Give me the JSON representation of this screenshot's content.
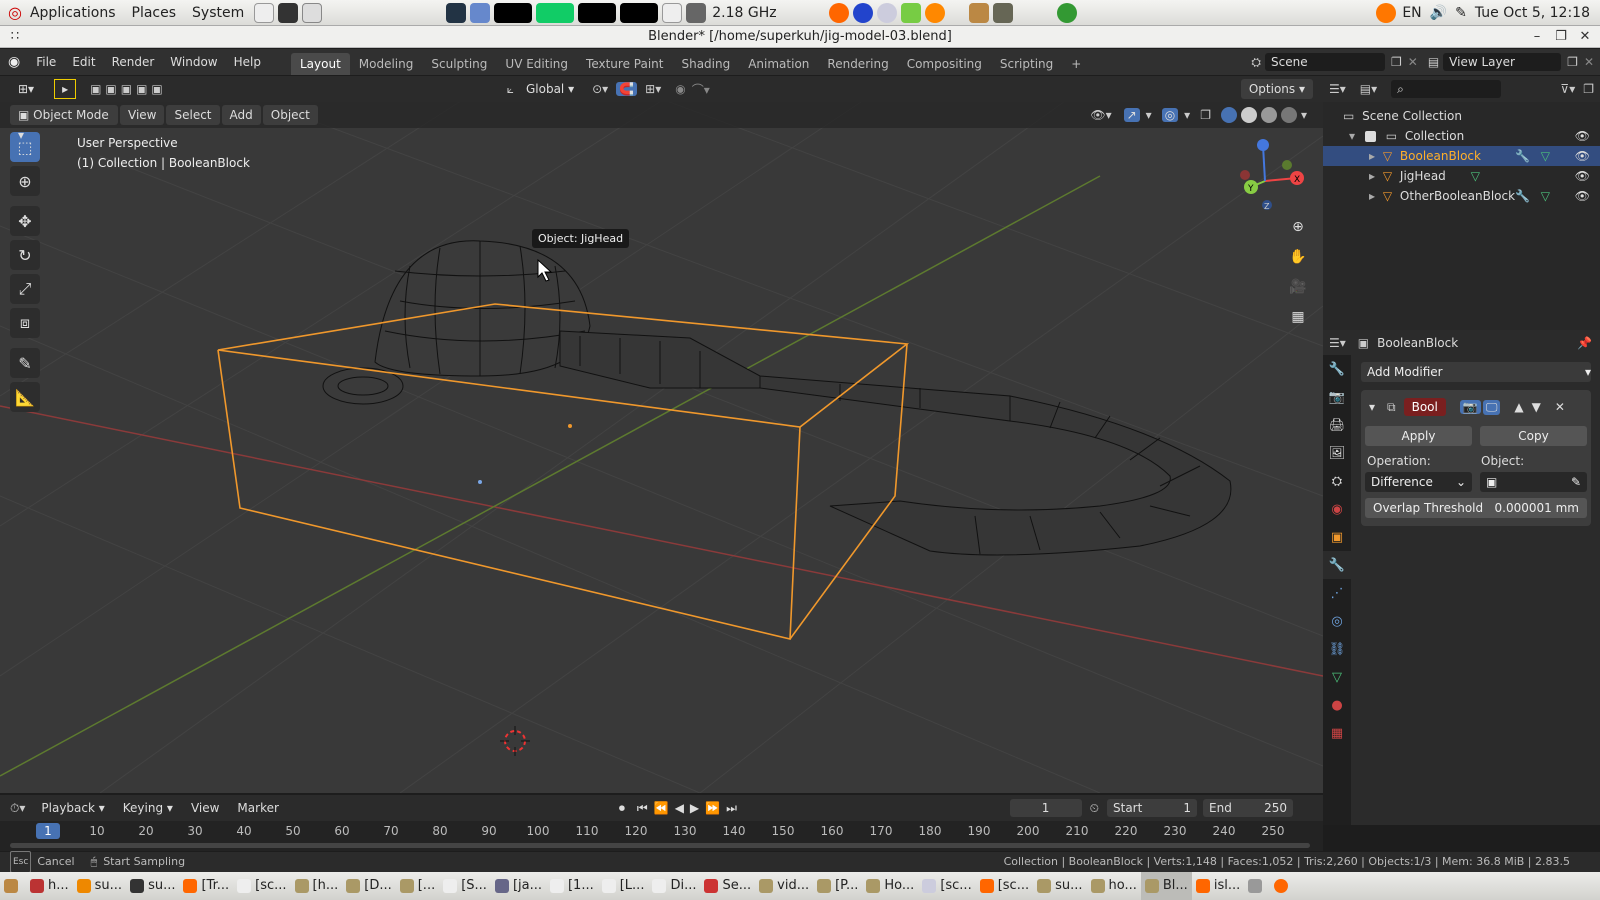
{
  "desktop_panel": {
    "menus": [
      "Applications",
      "Places",
      "System"
    ],
    "cpu": "2.18 GHz",
    "lang": "EN",
    "clock": "Tue Oct  5, 12:18"
  },
  "window": {
    "title": "Blender* [/home/superkuh/jig-model-03.blend]"
  },
  "topbar": {
    "menus": [
      "File",
      "Edit",
      "Render",
      "Window",
      "Help"
    ],
    "workspaces": [
      "Layout",
      "Modeling",
      "Sculpting",
      "UV Editing",
      "Texture Paint",
      "Shading",
      "Animation",
      "Rendering",
      "Compositing",
      "Scripting"
    ],
    "active_workspace": "Layout",
    "scene": "Scene",
    "view_layer": "View Layer"
  },
  "viewport": {
    "transform": "Global",
    "options": "Options",
    "mode": "Object Mode",
    "menus": [
      "View",
      "Select",
      "Add",
      "Object"
    ],
    "perspective": "User Perspective",
    "collection_label": "(1) Collection | BooleanBlock",
    "tooltip": "Object: JigHead"
  },
  "outliner": {
    "root": "Scene Collection",
    "collection": "Collection",
    "objects": [
      {
        "name": "BooleanBlock",
        "selected": true
      },
      {
        "name": "JigHead",
        "selected": false
      },
      {
        "name": "OtherBooleanBlock",
        "selected": false
      }
    ]
  },
  "properties": {
    "object": "BooleanBlock",
    "add_modifier": "Add Modifier",
    "modifier": {
      "name": "Bool",
      "apply": "Apply",
      "copy": "Copy",
      "operation_label": "Operation:",
      "operation": "Difference",
      "object_label": "Object:",
      "overlap_label": "Overlap Threshold",
      "overlap_value": "0.000001 mm"
    }
  },
  "timeline": {
    "menus": [
      "Playback",
      "Keying",
      "View",
      "Marker"
    ],
    "current_frame": "1",
    "start_label": "Start",
    "start": "1",
    "end_label": "End",
    "end": "250",
    "ticks": [
      "1",
      "10",
      "20",
      "30",
      "40",
      "50",
      "60",
      "70",
      "80",
      "90",
      "100",
      "110",
      "120",
      "130",
      "140",
      "150",
      "160",
      "170",
      "180",
      "190",
      "200",
      "210",
      "220",
      "230",
      "240",
      "250"
    ]
  },
  "status": {
    "cancel": "Cancel",
    "action": "Start Sampling",
    "stats": "Collection | BooleanBlock | Verts:1,148 | Faces:1,052 | Tris:2,260 | Objects:1/3 | Mem: 36.8 MiB | 2.83.5"
  },
  "taskbar": [
    "h...",
    "su...",
    "su...",
    "[Tr...",
    "[sc...",
    "[h...",
    "[D...",
    "[...",
    "[S...",
    "[ja...",
    "[1...",
    "[L...",
    "Di...",
    "Se...",
    "vid...",
    "[P...",
    "Ho...",
    "[sc...",
    "[sc...",
    "su...",
    "ho...",
    "Bl...",
    "isl..."
  ],
  "colors": {
    "accent": "#4772b3",
    "selected_orange": "#ffaf29",
    "viewport_bg": "#393939"
  }
}
